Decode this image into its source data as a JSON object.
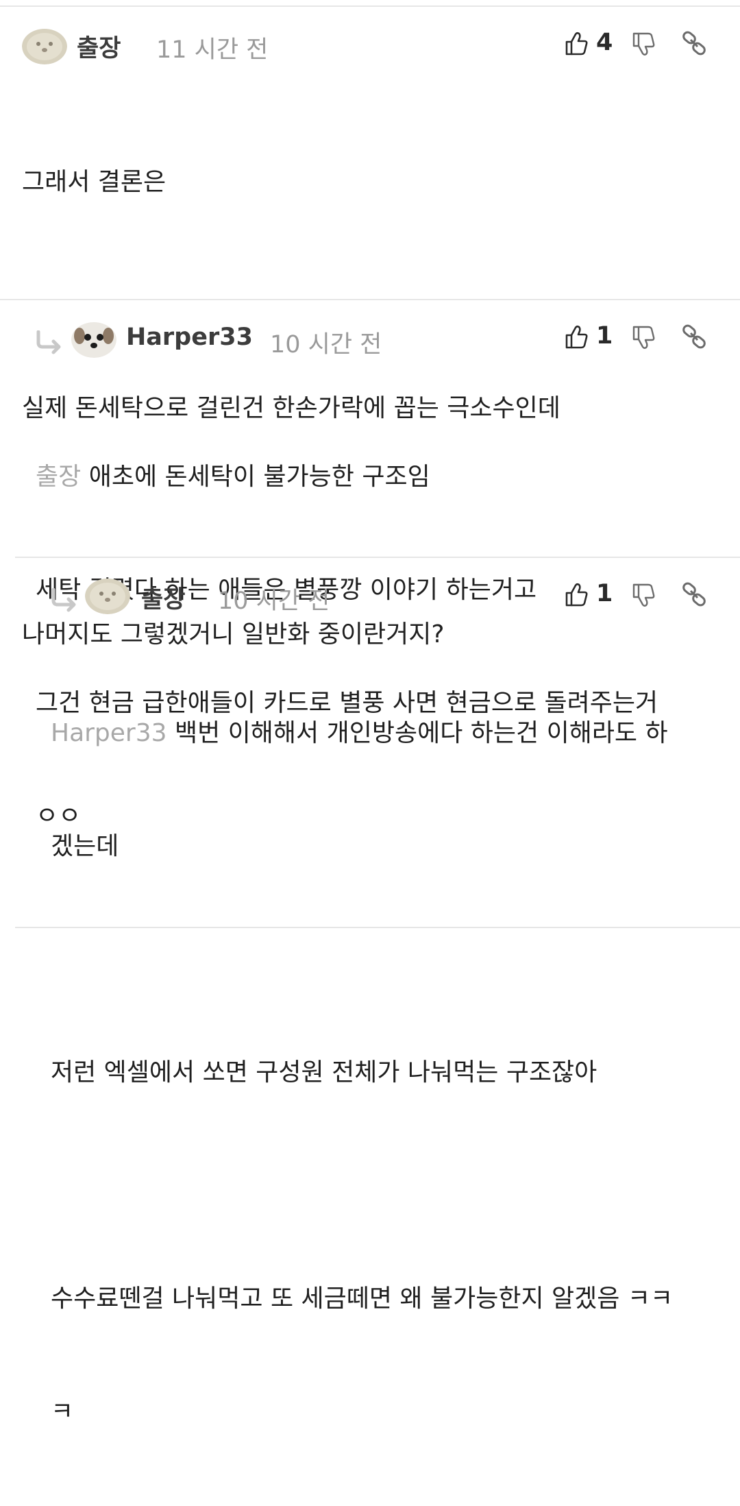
{
  "comments": [
    {
      "username": "출장",
      "time": "11 시간 전",
      "likes": "4",
      "mention": "",
      "lines": [
        "그래서 결론은",
        "",
        "실제 돈세탁으로 걸린건 한손가락에 꼽는 극소수인데",
        "",
        "나머지도 그렇겠거니 일반화 중이란거지?"
      ]
    },
    {
      "username": "Harper33",
      "time": "10 시간 전",
      "likes": "1",
      "mention": "출장",
      "lines": [
        "애초에 돈세탁이 불가능한 구조임",
        "세탁 걸렸다 하는 애들은 별풍깡 이야기 하는거고",
        "그건 현금 급한애들이 카드로 별풍 사면 현금으로 돌려주는거",
        "ㅇㅇ"
      ]
    },
    {
      "username": "출장",
      "time": "10 시간 전",
      "likes": "1",
      "mention": "Harper33",
      "lines": [
        "백번 이해해서 개인방송에다 하는건 이해라도 하",
        "겠는데",
        "",
        "저런 엑셀에서 쏘면 구성원 전체가 나눠먹는 구조잖아",
        "",
        "수수료뗀걸 나눠먹고 또 세금떼면 왜 불가능한지 알겠음 ㅋㅋ",
        "ㅋ"
      ]
    }
  ],
  "colors": {
    "username": "#3c3c3c",
    "timestamp": "#9a9a9a",
    "mention": "#a8a8a8",
    "divider": "#e6e6e6",
    "icon": "#6b6b6b"
  }
}
